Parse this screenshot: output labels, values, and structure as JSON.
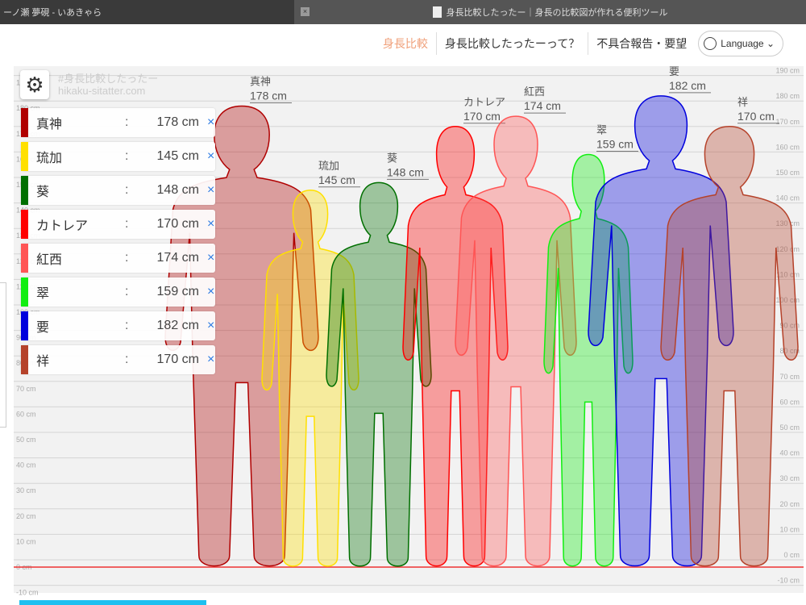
{
  "browser": {
    "tab1": "ーノ瀬 夢硯 - いあきゃら",
    "tab2": "身長比較したったー｜身長の比較図が作れる便利ツール",
    "close": "×"
  },
  "nav": {
    "items": [
      "身長比較",
      "身長比較したったーって？",
      "不具合報告・要望"
    ],
    "language": "Language ⌄"
  },
  "watermark": {
    "line1": "#身長比較したったー",
    "line2": "hikaku-sitatter.com"
  },
  "chart_data": {
    "type": "bar",
    "unit": "cm",
    "ylim": [
      -10,
      190
    ],
    "tick_step": 10,
    "characters": [
      {
        "name": "真神",
        "height": 178,
        "color": "#b00000",
        "value_label": "178 cm"
      },
      {
        "name": "琉加",
        "height": 145,
        "color": "#ffe000",
        "value_label": "145 cm"
      },
      {
        "name": "葵",
        "height": 148,
        "color": "#006f00",
        "value_label": "148 cm"
      },
      {
        "name": "カトレア",
        "height": 170,
        "color": "#ff0000",
        "value_label": "170 cm"
      },
      {
        "name": "紅西",
        "height": 174,
        "color": "#ff5555",
        "value_label": "174 cm"
      },
      {
        "name": "翠",
        "height": 159,
        "color": "#11ee11",
        "value_label": "159 cm"
      },
      {
        "name": "要",
        "height": 182,
        "color": "#0000dd",
        "value_label": "182 cm"
      },
      {
        "name": "祥",
        "height": 170,
        "color": "#b5422a",
        "value_label": "170 cm"
      }
    ]
  },
  "list": {
    "colon": ":",
    "delete": "×"
  }
}
